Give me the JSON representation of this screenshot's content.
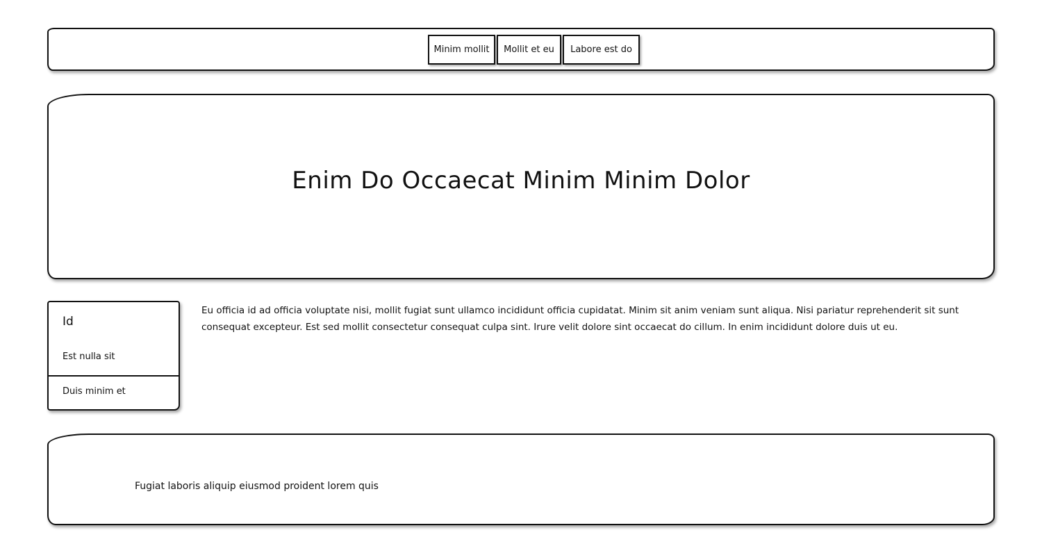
{
  "nav": {
    "tabs": [
      {
        "label": "Minim mollit"
      },
      {
        "label": "Mollit et eu"
      },
      {
        "label": "Labore est do"
      }
    ]
  },
  "hero": {
    "title": "Enim Do Occaecat Minim Minim Dolor"
  },
  "sidebar": {
    "heading": "Id",
    "items": [
      {
        "label": "Est nulla sit"
      },
      {
        "label": "Duis minim et"
      }
    ]
  },
  "main": {
    "paragraph": "Eu officia id ad officia voluptate nisi, mollit fugiat sunt ullamco incididunt officia cupidatat. Minim sit anim veniam sunt aliqua. Nisi pariatur reprehenderit sit sunt consequat excepteur. Est sed mollit consectetur consequat culpa sint. Irure velit dolore sint occaecat do cillum. In enim incididunt dolore duis ut eu."
  },
  "footer": {
    "text": "Fugiat laboris aliquip eiusmod proident lorem quis"
  }
}
